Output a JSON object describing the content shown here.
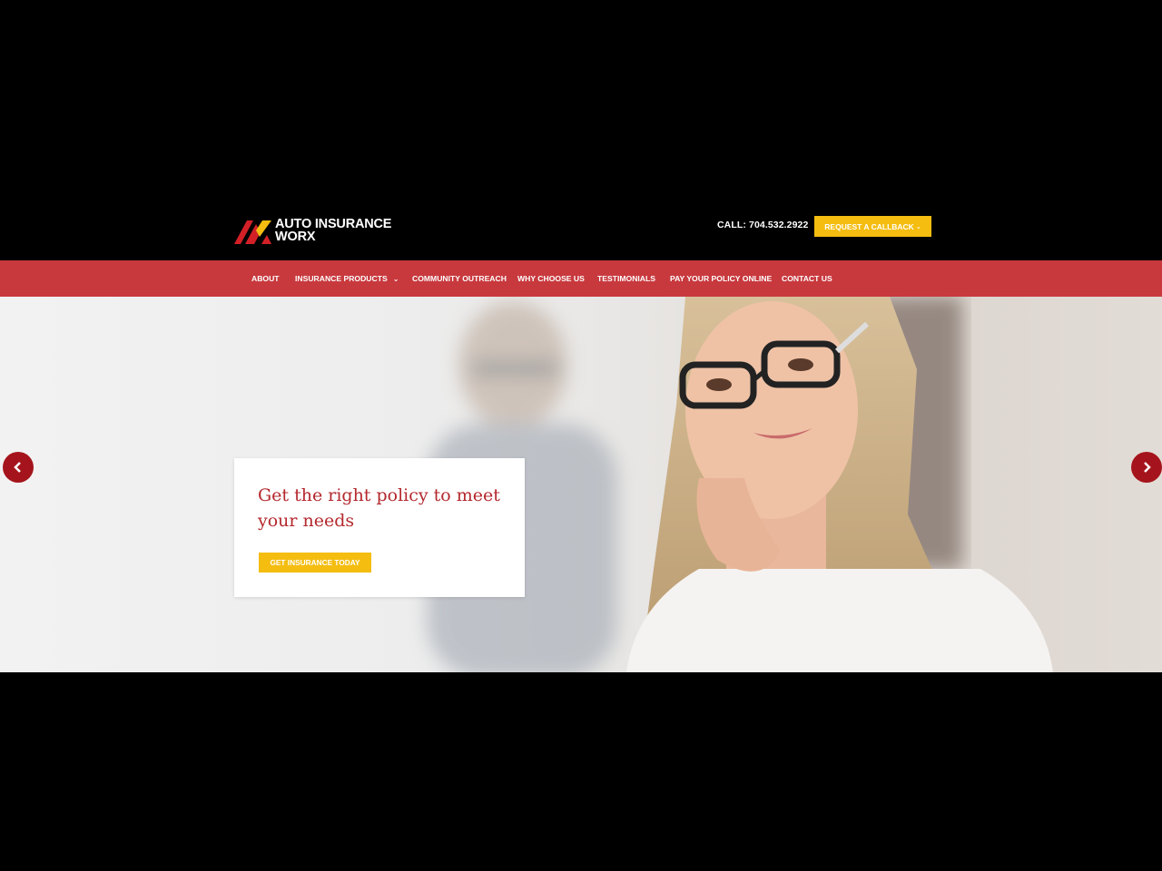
{
  "header": {
    "logo": {
      "line1": "AUTO INSURANCE",
      "line2": "WORX",
      "colors": {
        "red": "#d32027",
        "yellow": "#f4bd10"
      }
    },
    "call_text": "CALL: 704.532.2922",
    "callback_button": {
      "label": "REQUEST A CALLBACK",
      "icon": "chevron-down-icon"
    }
  },
  "nav": {
    "items": [
      {
        "label": "ABOUT"
      },
      {
        "label": "INSURANCE PRODUCTS",
        "icon": "chevron-down-icon"
      },
      {
        "label": "COMMUNITY OUTREACH"
      },
      {
        "label": "WHY CHOOSE US"
      },
      {
        "label": "TESTIMONIALS"
      },
      {
        "label": "PAY YOUR POLICY ONLINE"
      },
      {
        "label": "CONTACT US"
      }
    ]
  },
  "hero": {
    "heading": "Get the right policy to meet your needs",
    "cta_label": "GET INSURANCE TODAY",
    "prev_icon": "chevron-left-icon",
    "next_icon": "chevron-right-icon"
  },
  "colors": {
    "background": "#000000",
    "nav": "#c8393e",
    "accent": "#f4bd10",
    "heading": "#b4282d",
    "arrow": "#a5141c"
  }
}
